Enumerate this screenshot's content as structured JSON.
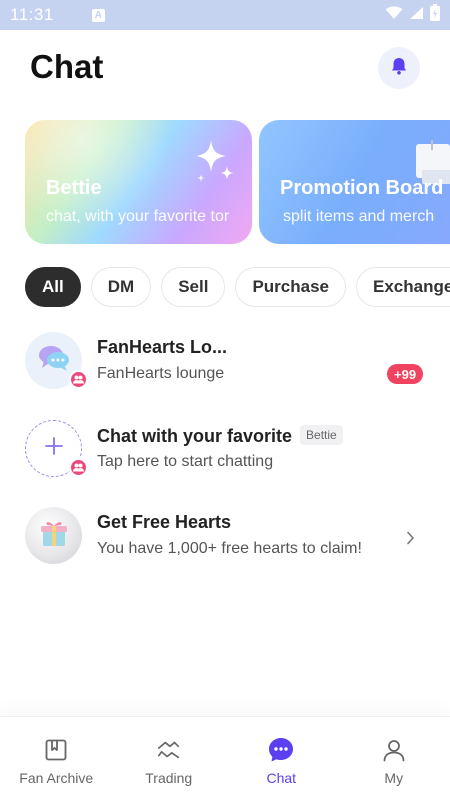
{
  "status_bar": {
    "time": "11:31",
    "notification_glyph": "A",
    "icons": [
      "wifi-icon",
      "signal-icon",
      "battery-icon"
    ]
  },
  "header": {
    "title": "Chat",
    "bell_icon": "bell-icon"
  },
  "banners": [
    {
      "title": "Bettie",
      "subtitle": "chat, with your favorite tor",
      "decoration": "sparkle-icon"
    },
    {
      "title": "Promotion Board",
      "subtitle": "split items and merch",
      "decoration": "note-icon"
    }
  ],
  "filters": {
    "tabs": [
      {
        "label": "All",
        "active": true
      },
      {
        "label": "DM",
        "active": false
      },
      {
        "label": "Sell",
        "active": false
      },
      {
        "label": "Purchase",
        "active": false
      },
      {
        "label": "Exchange",
        "active": false
      }
    ]
  },
  "chats": [
    {
      "title": "FanHearts Lo...",
      "subtitle": "FanHearts lounge",
      "badge": "+99",
      "avatar_icon": "chat-bubbles-icon",
      "group": true
    },
    {
      "title": "Chat with your favorite",
      "tag": "Bettie",
      "subtitle": "Tap here to start chatting",
      "avatar_icon": "plus-icon",
      "group": true
    },
    {
      "title": "Get Free Hearts",
      "subtitle": "You have 1,000+ free hearts to claim!",
      "avatar_icon": "gift-icon",
      "group": false
    }
  ],
  "bottom_nav": {
    "items": [
      {
        "label": "Fan Archive",
        "icon": "archive-icon",
        "active": false
      },
      {
        "label": "Trading",
        "icon": "trading-icon",
        "active": false
      },
      {
        "label": "Chat",
        "icon": "chat-icon",
        "active": true
      },
      {
        "label": "My",
        "icon": "user-icon",
        "active": false
      }
    ]
  },
  "colors": {
    "status_bar": "#c5d3f0",
    "accent": "#5b3ff0",
    "badge": "#f0435f",
    "active_chip": "#2d2d2d"
  }
}
